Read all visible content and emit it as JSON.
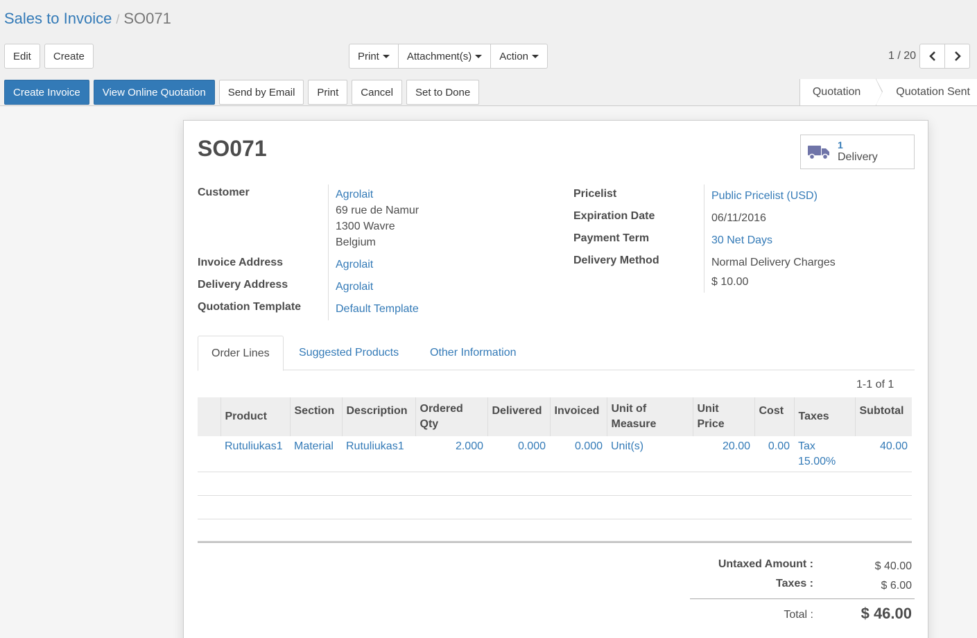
{
  "breadcrumb": {
    "parent": "Sales to Invoice",
    "separator": "/",
    "current": "SO071"
  },
  "toolbar": {
    "edit": "Edit",
    "create": "Create",
    "print": "Print",
    "attachments": "Attachment(s)",
    "action": "Action"
  },
  "pager": {
    "value": "1 / 20"
  },
  "status_actions": {
    "create_invoice": "Create Invoice",
    "view_online_quotation": "View Online Quotation",
    "send_by_email": "Send by Email",
    "print": "Print",
    "cancel": "Cancel",
    "set_to_done": "Set to Done"
  },
  "stages": {
    "first": "Quotation",
    "active": "Quotation Sent"
  },
  "record": {
    "name": "SO071",
    "smart_button": {
      "count": "1",
      "label": "Delivery",
      "icon": "truck-icon"
    },
    "customer_label": "Customer",
    "customer": "Agrolait",
    "address_line1": "69 rue de Namur",
    "address_line2": "1300 Wavre",
    "address_line3": "Belgium",
    "invoice_address_label": "Invoice Address",
    "invoice_address": "Agrolait",
    "delivery_address_label": "Delivery Address",
    "delivery_address": "Agrolait",
    "quotation_template_label": "Quotation Template",
    "quotation_template": "Default Template",
    "pricelist_label": "Pricelist",
    "pricelist": "Public Pricelist (USD)",
    "expiration_label": "Expiration Date",
    "expiration": "06/11/2016",
    "payment_term_label": "Payment Term",
    "payment_term": "30 Net Days",
    "delivery_method_label": "Delivery Method",
    "delivery_method": "Normal Delivery Charges",
    "delivery_price": "$ 10.00"
  },
  "tabs": {
    "order_lines": "Order Lines",
    "suggested_products": "Suggested Products",
    "other_information": "Other Information"
  },
  "list_pager": "1-1 of 1",
  "table": {
    "headers": {
      "product": "Product",
      "section": "Section",
      "description": "Description",
      "ordered_qty_1": "Ordered",
      "ordered_qty_2": "Qty",
      "delivered": "Delivered",
      "invoiced": "Invoiced",
      "uom_1": "Unit of",
      "uom_2": "Measure",
      "unit_price_1": "Unit",
      "unit_price_2": "Price",
      "cost": "Cost",
      "taxes": "Taxes",
      "subtotal": "Subtotal"
    },
    "rows": [
      {
        "product": "Rutuliukas1",
        "section": "Material",
        "description": "Rutuliukas1",
        "ordered_qty": "2.000",
        "delivered": "0.000",
        "invoiced": "0.000",
        "uom": "Unit(s)",
        "unit_price": "20.00",
        "cost": "0.00",
        "taxes_1": "Tax",
        "taxes_2": "15.00%",
        "subtotal": "40.00"
      }
    ]
  },
  "totals": {
    "untaxed_label": "Untaxed Amount :",
    "untaxed": "$ 40.00",
    "taxes_label": "Taxes :",
    "taxes": "$ 6.00",
    "total_label": "Total :",
    "total": "$ 46.00"
  },
  "colors": {
    "primary": "#337ab7",
    "link": "#337ab7",
    "text": "#4c4c4c"
  }
}
